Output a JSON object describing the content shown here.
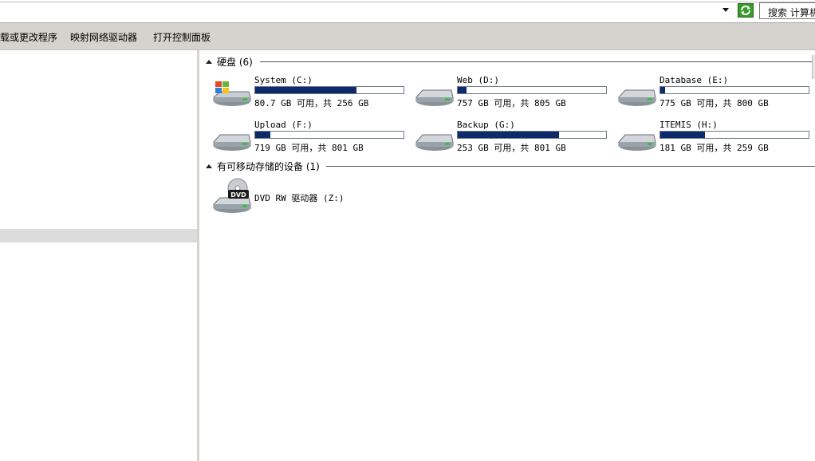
{
  "search": {
    "placeholder": "搜索 计算机"
  },
  "commands": [
    {
      "label": "载或更改程序"
    },
    {
      "label": "映射网络驱动器"
    },
    {
      "label": "打开控制面板"
    }
  ],
  "groups": {
    "hard_disks": {
      "title": "硬盘 (6)"
    },
    "removable": {
      "title": "有可移动存储的设备 (1)"
    }
  },
  "drives": [
    {
      "name": "System (C:)",
      "free_text": "80.7 GB 可用，共 256 GB",
      "used_fraction": 0.685,
      "icon": "windows-drive-icon"
    },
    {
      "name": "Web (D:)",
      "free_text": "757 GB 可用，共 805 GB",
      "used_fraction": 0.06,
      "icon": "hard-drive-icon"
    },
    {
      "name": "Database (E:)",
      "free_text": "775 GB 可用，共 800 GB",
      "used_fraction": 0.031,
      "icon": "hard-drive-icon"
    },
    {
      "name": "Upload (F:)",
      "free_text": "719 GB 可用，共 801 GB",
      "used_fraction": 0.102,
      "icon": "hard-drive-icon"
    },
    {
      "name": "Backup (G:)",
      "free_text": "253 GB 可用，共 801 GB",
      "used_fraction": 0.684,
      "icon": "hard-drive-icon"
    },
    {
      "name": "ITEMIS (H:)",
      "free_text": "181 GB 可用，共 259 GB",
      "used_fraction": 0.301,
      "icon": "hard-drive-icon"
    }
  ],
  "removable_drives": [
    {
      "name": "DVD RW 驱动器 (Z:)",
      "icon": "dvd-drive-icon",
      "badge": "DVD"
    }
  ],
  "colors": {
    "usage_bar": "#0d2a6b",
    "command_bar": "#d6d3ce"
  }
}
